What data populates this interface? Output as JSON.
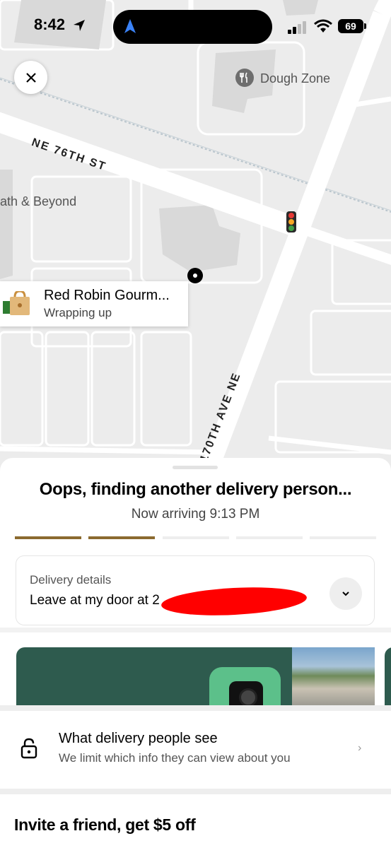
{
  "status_bar": {
    "time": "8:42",
    "battery": "69"
  },
  "map": {
    "poi_dough_zone": "Dough Zone",
    "poi_bath_beyond": "ath & Beyond",
    "street_ne_76th": "NE 76TH ST",
    "street_170th_ave": "170TH AVE NE"
  },
  "restaurant_card": {
    "name": "Red Robin Gourm...",
    "status": "Wrapping up"
  },
  "sheet": {
    "title": "Oops, finding another delivery person...",
    "subtitle": "Now arriving 9:13 PM",
    "progress": {
      "segments": 5,
      "completed": 2,
      "active_color": "#8b6a2f",
      "inactive_color": "#eeeeee"
    },
    "delivery_details": {
      "label": "Delivery details",
      "value": "Leave at my door at 2"
    },
    "privacy": {
      "title": "What delivery people see",
      "subtitle": "We limit which info they can view about you",
      "chevron": "›"
    },
    "invite": "Invite a friend, get $5 off"
  },
  "icons": [
    "location-arrow-icon",
    "navigation-arrow-icon",
    "cellular-signal-icon",
    "wifi-icon",
    "battery-icon",
    "close-icon",
    "restaurant-icon",
    "shopping-bag-icon",
    "traffic-light-icon",
    "destination-marker-icon",
    "chevron-down-icon",
    "lock-icon",
    "chevron-right-icon"
  ]
}
